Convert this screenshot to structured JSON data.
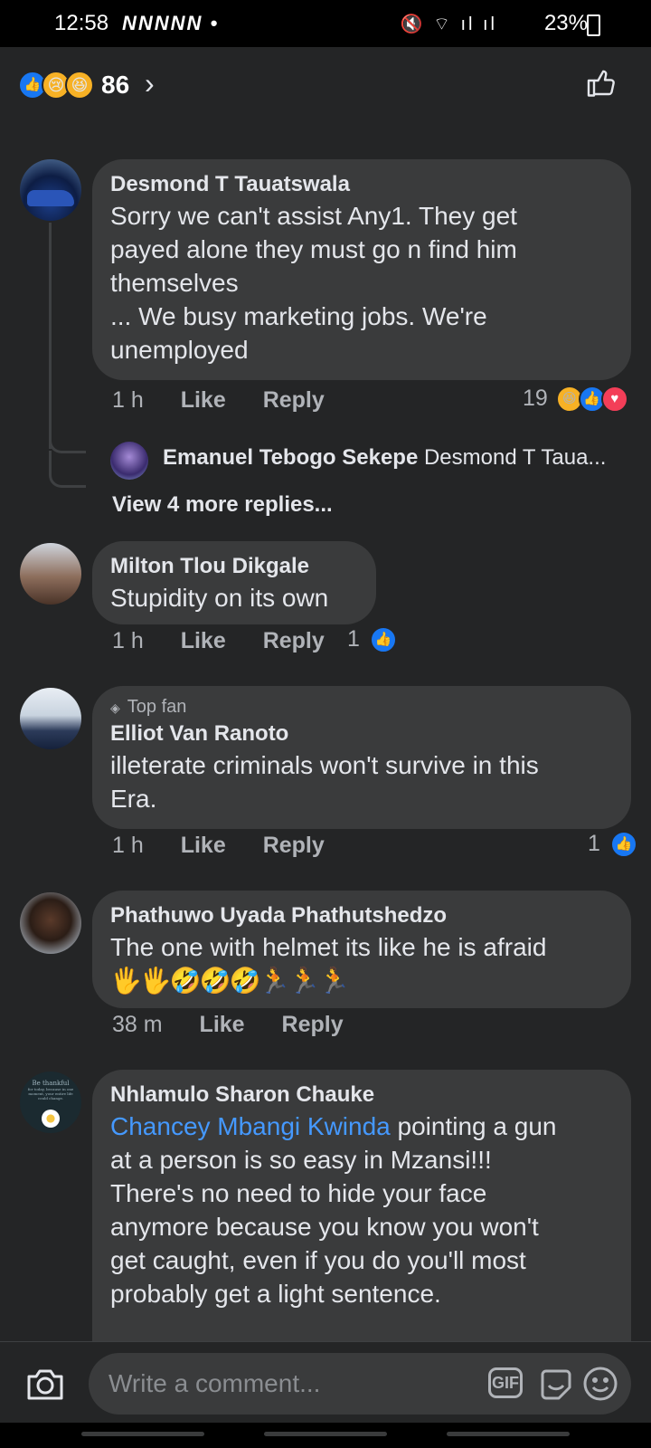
{
  "status_bar": {
    "time": "12:58",
    "notifications": "NNNNN •",
    "battery": "23%"
  },
  "header": {
    "reaction_count": "86"
  },
  "comments": [
    {
      "author": "Desmond T Tauatswala",
      "text": "Sorry we can't assist Any1. They get\npayed alone they must go n find him\nthemselves\n... We busy marketing jobs. We're\nunemployed",
      "time": "1 h",
      "like": "Like",
      "reply": "Reply",
      "reactions": "19"
    },
    {
      "author": "Milton Tlou Dikgale",
      "text": "Stupidity on its own",
      "time": "1 h",
      "like": "Like",
      "reply": "Reply",
      "reactions": "1"
    },
    {
      "badge": "Top fan",
      "author": "Elliot Van Ranoto",
      "text": "illeterate criminals won't survive in this\nEra.",
      "time": "1 h",
      "like": "Like",
      "reply": "Reply",
      "reactions": "1"
    },
    {
      "author": "Phathuwo Uyada Phathutshedzo",
      "text": "The one with helmet its like he is afraid",
      "emojis": "🖐🖐🤣🤣🤣🏃🏃🏃",
      "time": "38 m",
      "like": "Like",
      "reply": "Reply"
    },
    {
      "author": "Nhlamulo Sharon Chauke",
      "mention": "Chancey Mbangi Kwinda",
      "text": " pointing a gun\nat a person is so easy in Mzansi!!!\nThere's no need to hide your face\nanymore because you know you won't\nget caught, even if you do you'll most\nprobably get a light sentence."
    }
  ],
  "reply_preview": {
    "author": "Emanuel Tebogo Sekepe",
    "snippet": "Desmond T Taua..."
  },
  "view_more": "View 4 more replies...",
  "avatar_quote": {
    "line1": "Be thankful",
    "line2": "for today, because in one",
    "line3": "moment, your entire life",
    "line4": "could change."
  },
  "composer": {
    "placeholder": "Write a comment...",
    "gif_label": "GIF"
  },
  "colors": {
    "accent": "#1877f2",
    "link": "#4599ff",
    "love": "#f33e58",
    "haha": "#f7b125"
  }
}
